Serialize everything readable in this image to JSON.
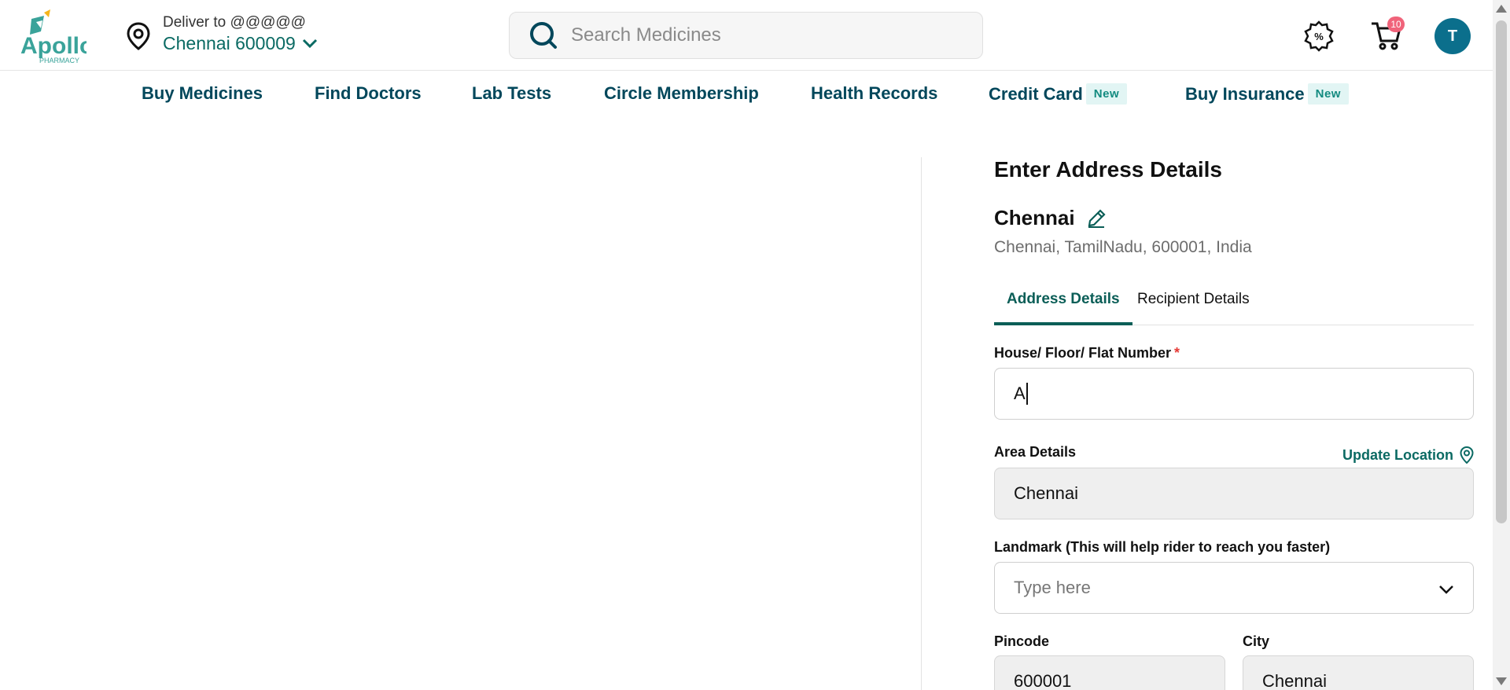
{
  "header": {
    "logo_text": "Apollo",
    "logo_sub": "PHARMACY",
    "deliver_label": "Deliver to @@@@@",
    "deliver_city": "Chennai 600009",
    "search_placeholder": "Search Medicines",
    "cart_count": "10",
    "avatar_initial": "T"
  },
  "nav": [
    {
      "label": "Buy Medicines"
    },
    {
      "label": "Find Doctors"
    },
    {
      "label": "Lab Tests"
    },
    {
      "label": "Circle Membership"
    },
    {
      "label": "Health Records"
    },
    {
      "label": "Credit Card",
      "badge": "New"
    },
    {
      "label": "Buy Insurance",
      "badge": "New"
    }
  ],
  "form": {
    "title": "Enter Address Details",
    "city_name": "Chennai",
    "city_address": "Chennai, TamilNadu, 600001, India",
    "tabs": [
      "Address Details",
      "Recipient Details"
    ],
    "house_label": "House/ Floor/ Flat Number",
    "house_required": "*",
    "house_value": "A",
    "area_label": "Area Details",
    "update_location": "Update Location",
    "area_value": "Chennai",
    "landmark_label": "Landmark (This will help rider to reach you faster)",
    "landmark_placeholder": "Type here",
    "pincode_label": "Pincode",
    "pincode_value": "600001",
    "city_label": "City",
    "city_value": "Chennai"
  },
  "colors": {
    "brand": "#0b5e57",
    "accent": "#02475b",
    "badge": "#f0637a",
    "new_badge_bg": "#e2f5f4"
  }
}
